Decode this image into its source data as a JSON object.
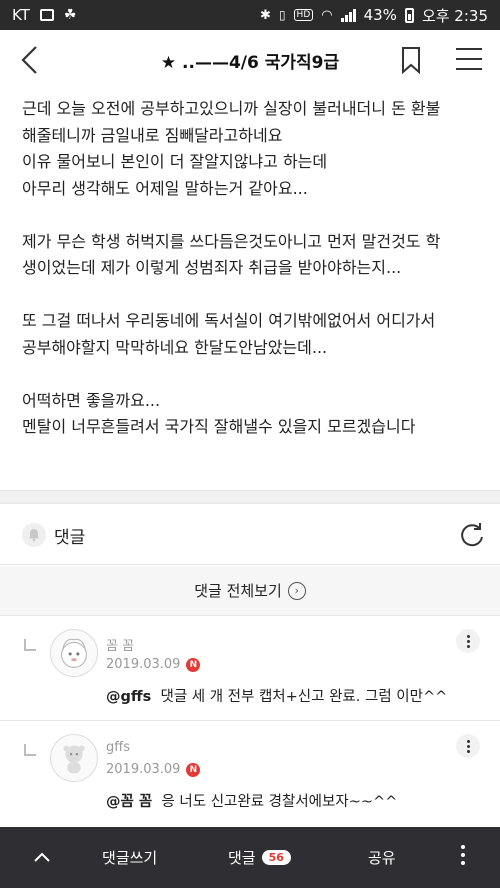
{
  "status_bar": {
    "carrier": "KT",
    "battery": "43%",
    "time_label": "오후 2:35",
    "hd_label": "HD",
    "icons": [
      "image-icon",
      "game-icon",
      "bluetooth-icon",
      "vibrate-icon",
      "hd-icon",
      "wifi-icon",
      "signal-icon",
      "battery-icon"
    ]
  },
  "header": {
    "title": "★ ..——4/6 국가직9급",
    "icons": {
      "back": "back-chevron-icon",
      "bookmark": "bookmark-icon",
      "menu": "hamburger-menu-icon"
    }
  },
  "article": {
    "lines": [
      "근데 오늘 오전에 공부하고있으니까 실장이 불러내더니 돈 환불",
      "해줄테니까 금일내로 짐빼달라고하네요",
      "이유 물어보니 본인이 더 잘알지않냐고 하는데",
      "아무리 생각해도 어제일 말하는거 같아요...",
      "",
      "제가 무슨 학생 허벅지를 쓰다듬은것도아니고 먼저 말건것도 학",
      "생이었는데 제가 이렇게 성범죄자 취급을 받아야하는지...",
      "",
      "또 그걸 떠나서 우리동네에 독서실이 여기밖에없어서 어디가서",
      "공부해야할지 막막하네요 한달도안남았는데...",
      "",
      "어떡하면 좋을까요...",
      "멘탈이 너무흔들려서 국가직 잘해낼수 있을지 모르겠습니다"
    ]
  },
  "comments_section": {
    "label": "댓글",
    "view_all": "댓글 전체보기",
    "icons": {
      "bell": "bell-icon",
      "refresh": "refresh-icon",
      "chevron": "chevron-right-circle-icon"
    }
  },
  "comments": [
    {
      "author": "꼼 꼼",
      "date": "2019.03.09",
      "new_badge": "N",
      "mention": "@gffs",
      "text": "댓글 세 개 전부 캡처+신고 완료. 그럼 이만^^"
    },
    {
      "author": "gffs",
      "date": "2019.03.09",
      "new_badge": "N",
      "mention": "@꼼 꼼",
      "text": "응 너도 신고완료 경찰서에보자~~^^"
    }
  ],
  "bottom_bar": {
    "write": "댓글쓰기",
    "comments": "댓글",
    "comment_count": "56",
    "share": "공유",
    "icons": {
      "up": "chevron-up-icon",
      "more": "more-vertical-icon"
    }
  },
  "colors": {
    "status_bar_bg": "#2b2b2b",
    "bottom_bar_bg": "#2f2f33",
    "badge_red": "#e53935",
    "meta_gray": "#999999"
  }
}
